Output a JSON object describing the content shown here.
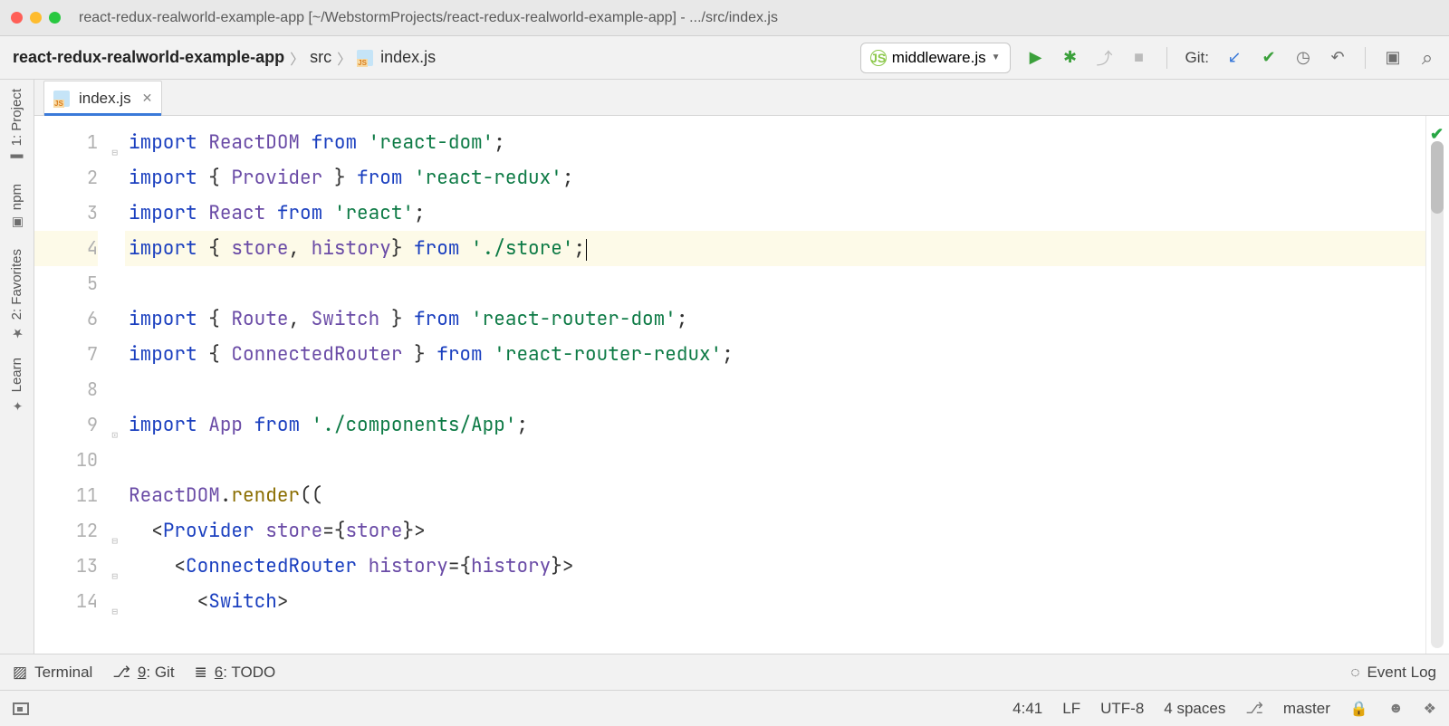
{
  "titlebar": {
    "title": "react-redux-realworld-example-app [~/WebstormProjects/react-redux-realworld-example-app] - .../src/index.js"
  },
  "breadcrumb": {
    "root": "react-redux-realworld-example-app",
    "mid": "src",
    "leaf": "index.js"
  },
  "run_config": {
    "name": "middleware.js"
  },
  "git_label": "Git:",
  "tab": {
    "name": "index.js"
  },
  "gutter_lines": [
    "1",
    "2",
    "3",
    "4",
    "5",
    "6",
    "7",
    "8",
    "9",
    "10",
    "11",
    "12",
    "13",
    "14"
  ],
  "code": {
    "l1": {
      "kw1": "import",
      "id": "ReactDOM",
      "kw2": "from",
      "str": "'react-dom'",
      "end": ";"
    },
    "l2": {
      "kw1": "import",
      "br1": "{ ",
      "id": "Provider",
      "br2": " } ",
      "kw2": "from",
      "str": "'react-redux'",
      "end": ";"
    },
    "l3": {
      "kw1": "import",
      "id": "React",
      "kw2": "from",
      "str": "'react'",
      "end": ";"
    },
    "l4": {
      "kw1": "import",
      "br1": "{ ",
      "id1": "store",
      "comma": ", ",
      "id2": "history",
      "br2": "} ",
      "kw2": "from",
      "str": "'./store'",
      "end": ";"
    },
    "l6": {
      "kw1": "import",
      "br1": "{ ",
      "id1": "Route",
      "comma": ", ",
      "id2": "Switch",
      "br2": " } ",
      "kw2": "from",
      "str": "'react-router-dom'",
      "end": ";"
    },
    "l7": {
      "kw1": "import",
      "br1": "{ ",
      "id": "ConnectedRouter",
      "br2": " } ",
      "kw2": "from",
      "str": "'react-router-redux'",
      "end": ";"
    },
    "l9": {
      "kw1": "import",
      "id": "App",
      "kw2": "from",
      "str": "'./components/App'",
      "end": ";"
    },
    "l11": {
      "obj": "ReactDOM",
      "dot": ".",
      "fn": "render",
      "paren": "(("
    },
    "l12": {
      "indent": "  ",
      "lt": "<",
      "tag": "Provider",
      "sp": " ",
      "attr": "store",
      "eq": "=",
      "br1": "{",
      "val": "store",
      "br2": "}",
      "gt": ">"
    },
    "l13": {
      "indent": "    ",
      "lt": "<",
      "tag": "ConnectedRouter",
      "sp": " ",
      "attr": "history",
      "eq": "=",
      "br1": "{",
      "val": "history",
      "br2": "}",
      "gt": ">"
    },
    "l14": {
      "indent": "      ",
      "lt": "<",
      "tag": "Switch",
      "gt": ">"
    }
  },
  "left_strip": {
    "project": "1: Project",
    "npm": "npm",
    "favorites": "2: Favorites",
    "learn": "Learn"
  },
  "bottom": {
    "terminal": "Terminal",
    "git_num": "9",
    "git": ": Git",
    "todo_num": "6",
    "todo": ": TODO",
    "eventlog": "Event Log"
  },
  "status": {
    "pos": "4:41",
    "linesep": "LF",
    "encoding": "UTF-8",
    "indent": "4 spaces",
    "branch": "master"
  }
}
